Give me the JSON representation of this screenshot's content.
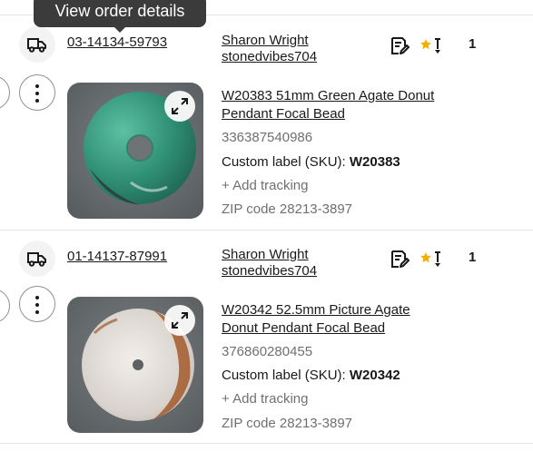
{
  "tooltip": {
    "text": "View order details"
  },
  "orders": [
    {
      "order_number": "03-14134-59793",
      "buyer_name": "Sharon Wright",
      "buyer_username": "stonedvibes704",
      "quantity": "1",
      "item_title_line1": "W20383 51mm Green Agate Donut",
      "item_title_line2": "Pendant Focal Bead",
      "item_number": "336387540986",
      "sku_label": "Custom label (SKU):",
      "sku_value": "W20383",
      "add_tracking": "+ Add tracking",
      "zip": "ZIP code 28213-3897",
      "icons": {
        "shipping": "truck-icon",
        "note": "note-edit-icon",
        "feedback": "star-feedback-icon",
        "more": "more-vertical-icon",
        "expand": "expand-icon"
      }
    },
    {
      "order_number": "01-14137-87991",
      "buyer_name": "Sharon Wright",
      "buyer_username": "stonedvibes704",
      "quantity": "1",
      "item_title_line1": "W20342 52.5mm Picture Agate",
      "item_title_line2": "Donut Pendant Focal Bead",
      "item_number": "376860280455",
      "sku_label": "Custom label (SKU):",
      "sku_value": "W20342",
      "add_tracking": "+ Add tracking",
      "zip": "ZIP code 28213-3897",
      "icons": {
        "shipping": "truck-icon",
        "note": "note-edit-icon",
        "feedback": "star-feedback-icon",
        "more": "more-vertical-icon",
        "expand": "expand-icon"
      }
    }
  ],
  "colors": {
    "text": "#191919",
    "muted": "#707070",
    "star": "#f5af02",
    "tooltip_bg": "#3b3b3b"
  }
}
